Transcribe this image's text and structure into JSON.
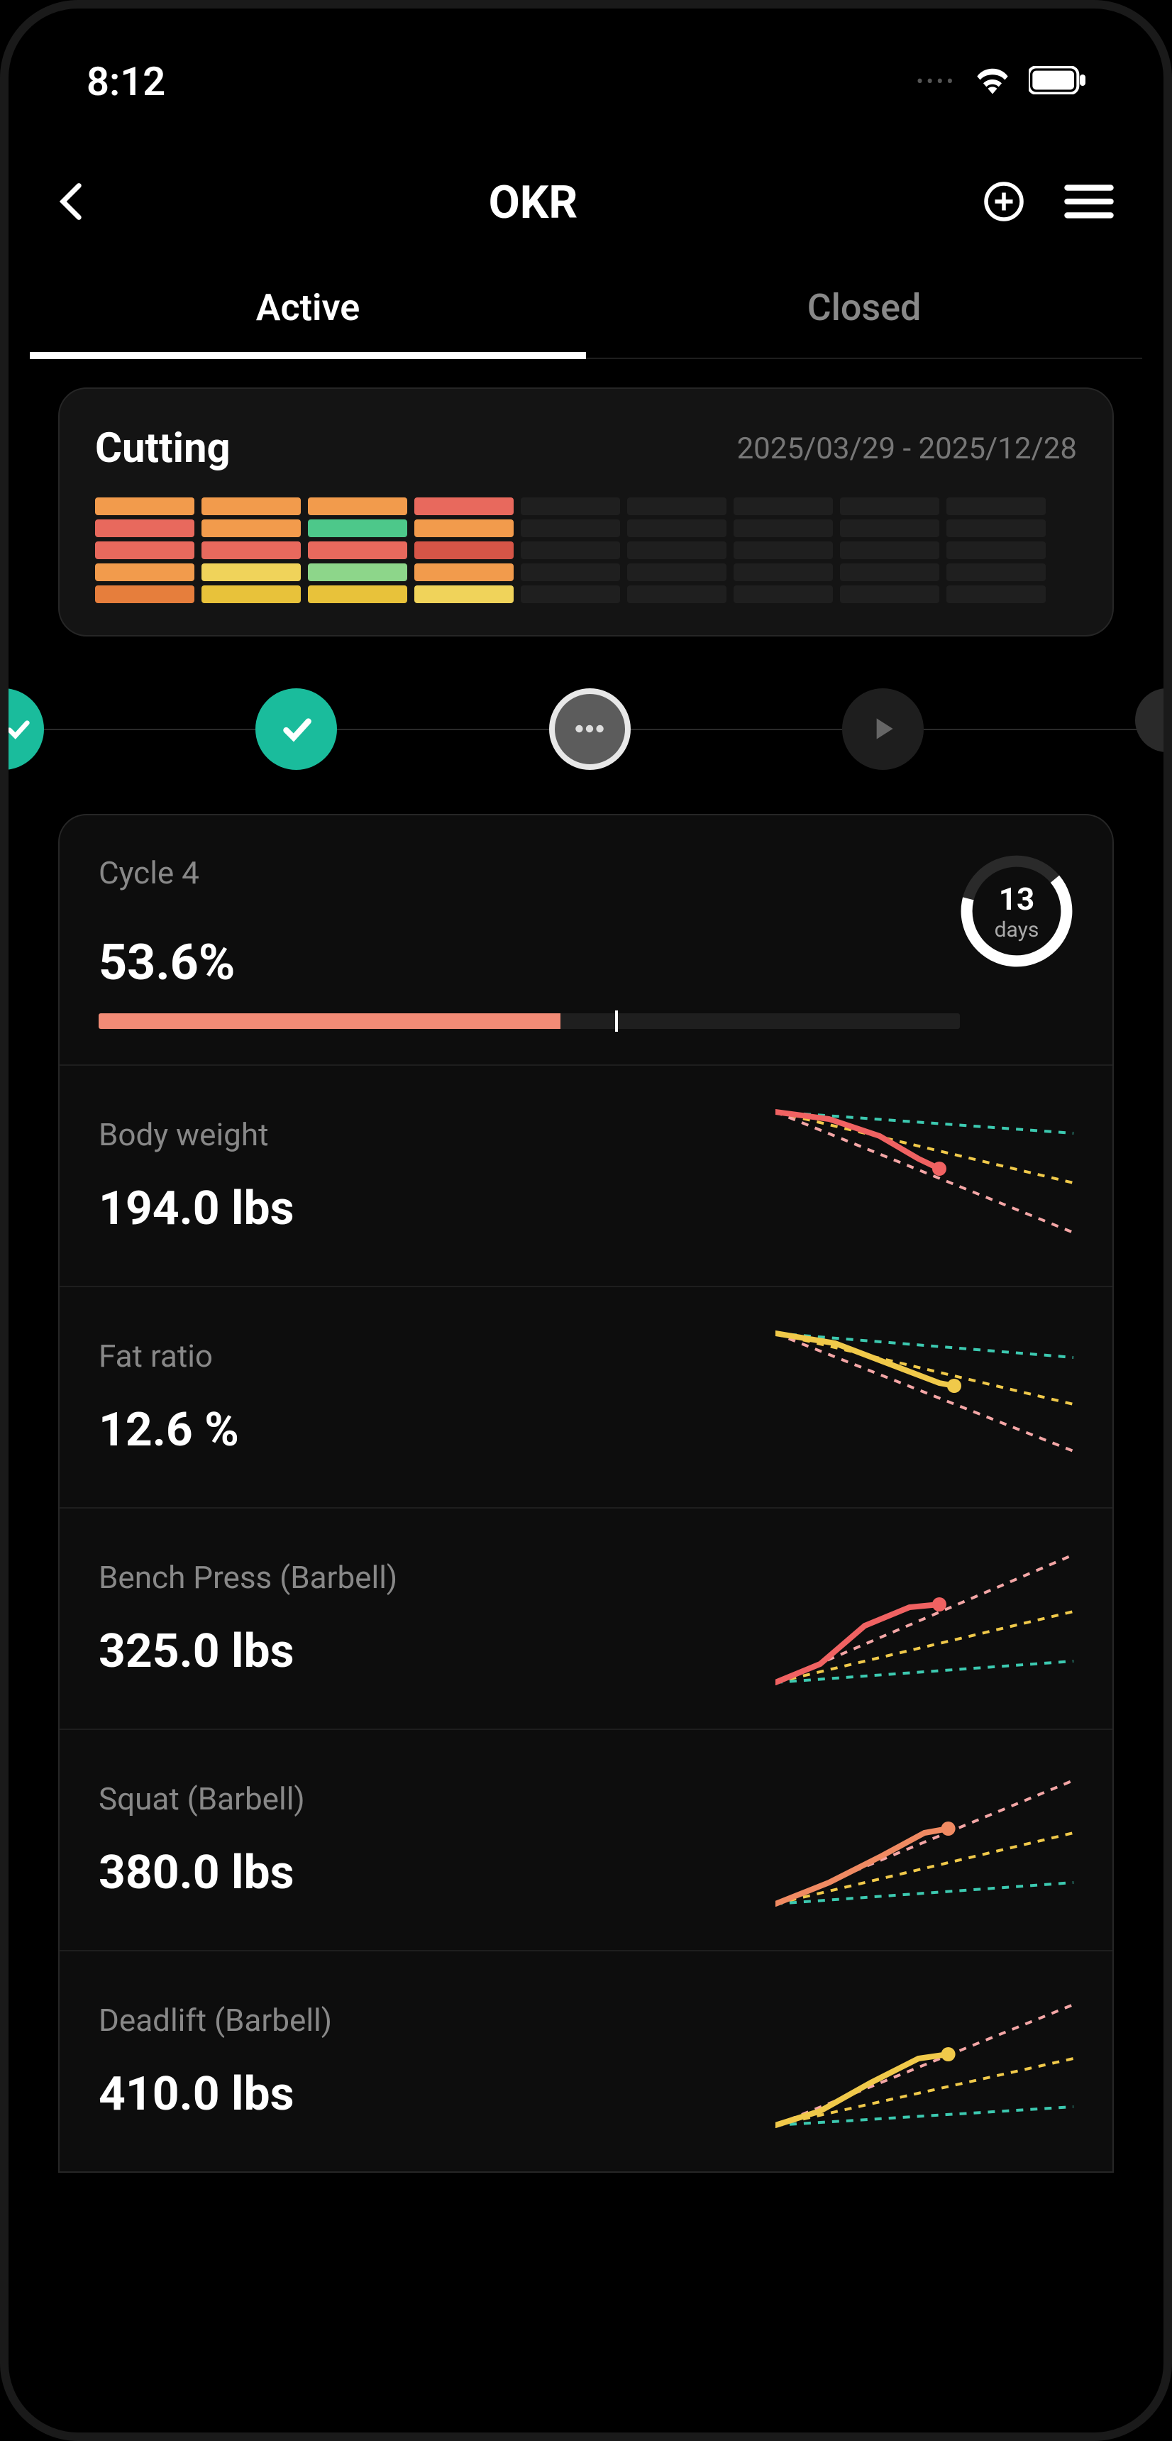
{
  "status": {
    "time": "8:12"
  },
  "header": {
    "title": "OKR"
  },
  "tabs": {
    "active": "Active",
    "closed": "Closed"
  },
  "cutting": {
    "title": "Cutting",
    "date_range": "2025/03/29 - 2025/12/28"
  },
  "cycle": {
    "label": "Cycle 4",
    "percent": "53.6%",
    "days_num": "13",
    "days_label": "days",
    "progress_pct": 53.6,
    "tick_pct": 60
  },
  "metrics": [
    {
      "label": "Body weight",
      "value": "194.0 lbs",
      "trend": "down",
      "color": "#f06262"
    },
    {
      "label": "Fat ratio",
      "value": "12.6 %",
      "trend": "down",
      "color": "#f0c94a"
    },
    {
      "label": "Bench Press (Barbell)",
      "value": "325.0 lbs",
      "trend": "up",
      "color": "#f06262"
    },
    {
      "label": "Squat (Barbell)",
      "value": "380.0 lbs",
      "trend": "up",
      "color": "#f08a62"
    },
    {
      "label": "Deadlift (Barbell)",
      "value": "410.0 lbs",
      "trend": "up",
      "color": "#f0c94a"
    }
  ],
  "chart_data": {
    "type": "line",
    "title": "OKR metric trends (sparklines with target bands)",
    "note": "Each metric shows actual trend line with a point marker against 3 dashed target trajectories (upper/mid/lower). Values are relative 0-100 sparkline coordinates estimated from pixels; direction matches metric trend.",
    "series": [
      {
        "name": "Body weight",
        "direction": "down",
        "actual_color": "#f06262",
        "actual": [
          {
            "x": 0,
            "y": 95
          },
          {
            "x": 18,
            "y": 90
          },
          {
            "x": 35,
            "y": 78
          },
          {
            "x": 48,
            "y": 62
          },
          {
            "x": 55,
            "y": 55
          }
        ],
        "marker": {
          "x": 55,
          "y": 55
        },
        "targets": {
          "upper": [
            {
              "x": 0,
              "y": 95
            },
            {
              "x": 100,
              "y": 80
            }
          ],
          "mid": [
            {
              "x": 0,
              "y": 95
            },
            {
              "x": 100,
              "y": 45
            }
          ],
          "lower": [
            {
              "x": 0,
              "y": 95
            },
            {
              "x": 100,
              "y": 10
            }
          ]
        }
      },
      {
        "name": "Fat ratio",
        "direction": "down",
        "actual_color": "#f0c94a",
        "actual": [
          {
            "x": 0,
            "y": 95
          },
          {
            "x": 20,
            "y": 88
          },
          {
            "x": 40,
            "y": 72
          },
          {
            "x": 55,
            "y": 60
          },
          {
            "x": 60,
            "y": 58
          }
        ],
        "marker": {
          "x": 60,
          "y": 58
        },
        "targets": {
          "upper": [
            {
              "x": 0,
              "y": 95
            },
            {
              "x": 100,
              "y": 78
            }
          ],
          "mid": [
            {
              "x": 0,
              "y": 95
            },
            {
              "x": 100,
              "y": 45
            }
          ],
          "lower": [
            {
              "x": 0,
              "y": 95
            },
            {
              "x": 100,
              "y": 12
            }
          ]
        }
      },
      {
        "name": "Bench Press (Barbell)",
        "direction": "up",
        "actual_color": "#f06262",
        "actual": [
          {
            "x": 0,
            "y": 5
          },
          {
            "x": 15,
            "y": 18
          },
          {
            "x": 30,
            "y": 45
          },
          {
            "x": 45,
            "y": 58
          },
          {
            "x": 55,
            "y": 60
          }
        ],
        "marker": {
          "x": 55,
          "y": 60
        },
        "targets": {
          "upper": [
            {
              "x": 0,
              "y": 5
            },
            {
              "x": 100,
              "y": 95
            }
          ],
          "mid": [
            {
              "x": 0,
              "y": 5
            },
            {
              "x": 100,
              "y": 55
            }
          ],
          "lower": [
            {
              "x": 0,
              "y": 5
            },
            {
              "x": 100,
              "y": 20
            }
          ]
        }
      },
      {
        "name": "Squat (Barbell)",
        "direction": "up",
        "actual_color": "#f08a62",
        "actual": [
          {
            "x": 0,
            "y": 5
          },
          {
            "x": 18,
            "y": 20
          },
          {
            "x": 35,
            "y": 38
          },
          {
            "x": 50,
            "y": 55
          },
          {
            "x": 58,
            "y": 58
          }
        ],
        "marker": {
          "x": 58,
          "y": 58
        },
        "targets": {
          "upper": [
            {
              "x": 0,
              "y": 5
            },
            {
              "x": 100,
              "y": 92
            }
          ],
          "mid": [
            {
              "x": 0,
              "y": 5
            },
            {
              "x": 100,
              "y": 55
            }
          ],
          "lower": [
            {
              "x": 0,
              "y": 5
            },
            {
              "x": 100,
              "y": 20
            }
          ]
        }
      },
      {
        "name": "Deadlift (Barbell)",
        "direction": "up",
        "actual_color": "#f0c94a",
        "actual": [
          {
            "x": 0,
            "y": 5
          },
          {
            "x": 15,
            "y": 15
          },
          {
            "x": 32,
            "y": 35
          },
          {
            "x": 48,
            "y": 52
          },
          {
            "x": 58,
            "y": 55
          }
        ],
        "marker": {
          "x": 58,
          "y": 55
        },
        "targets": {
          "upper": [
            {
              "x": 0,
              "y": 5
            },
            {
              "x": 100,
              "y": 90
            }
          ],
          "mid": [
            {
              "x": 0,
              "y": 5
            },
            {
              "x": 100,
              "y": 52
            }
          ],
          "lower": [
            {
              "x": 0,
              "y": 5
            },
            {
              "x": 100,
              "y": 18
            }
          ]
        }
      }
    ]
  }
}
